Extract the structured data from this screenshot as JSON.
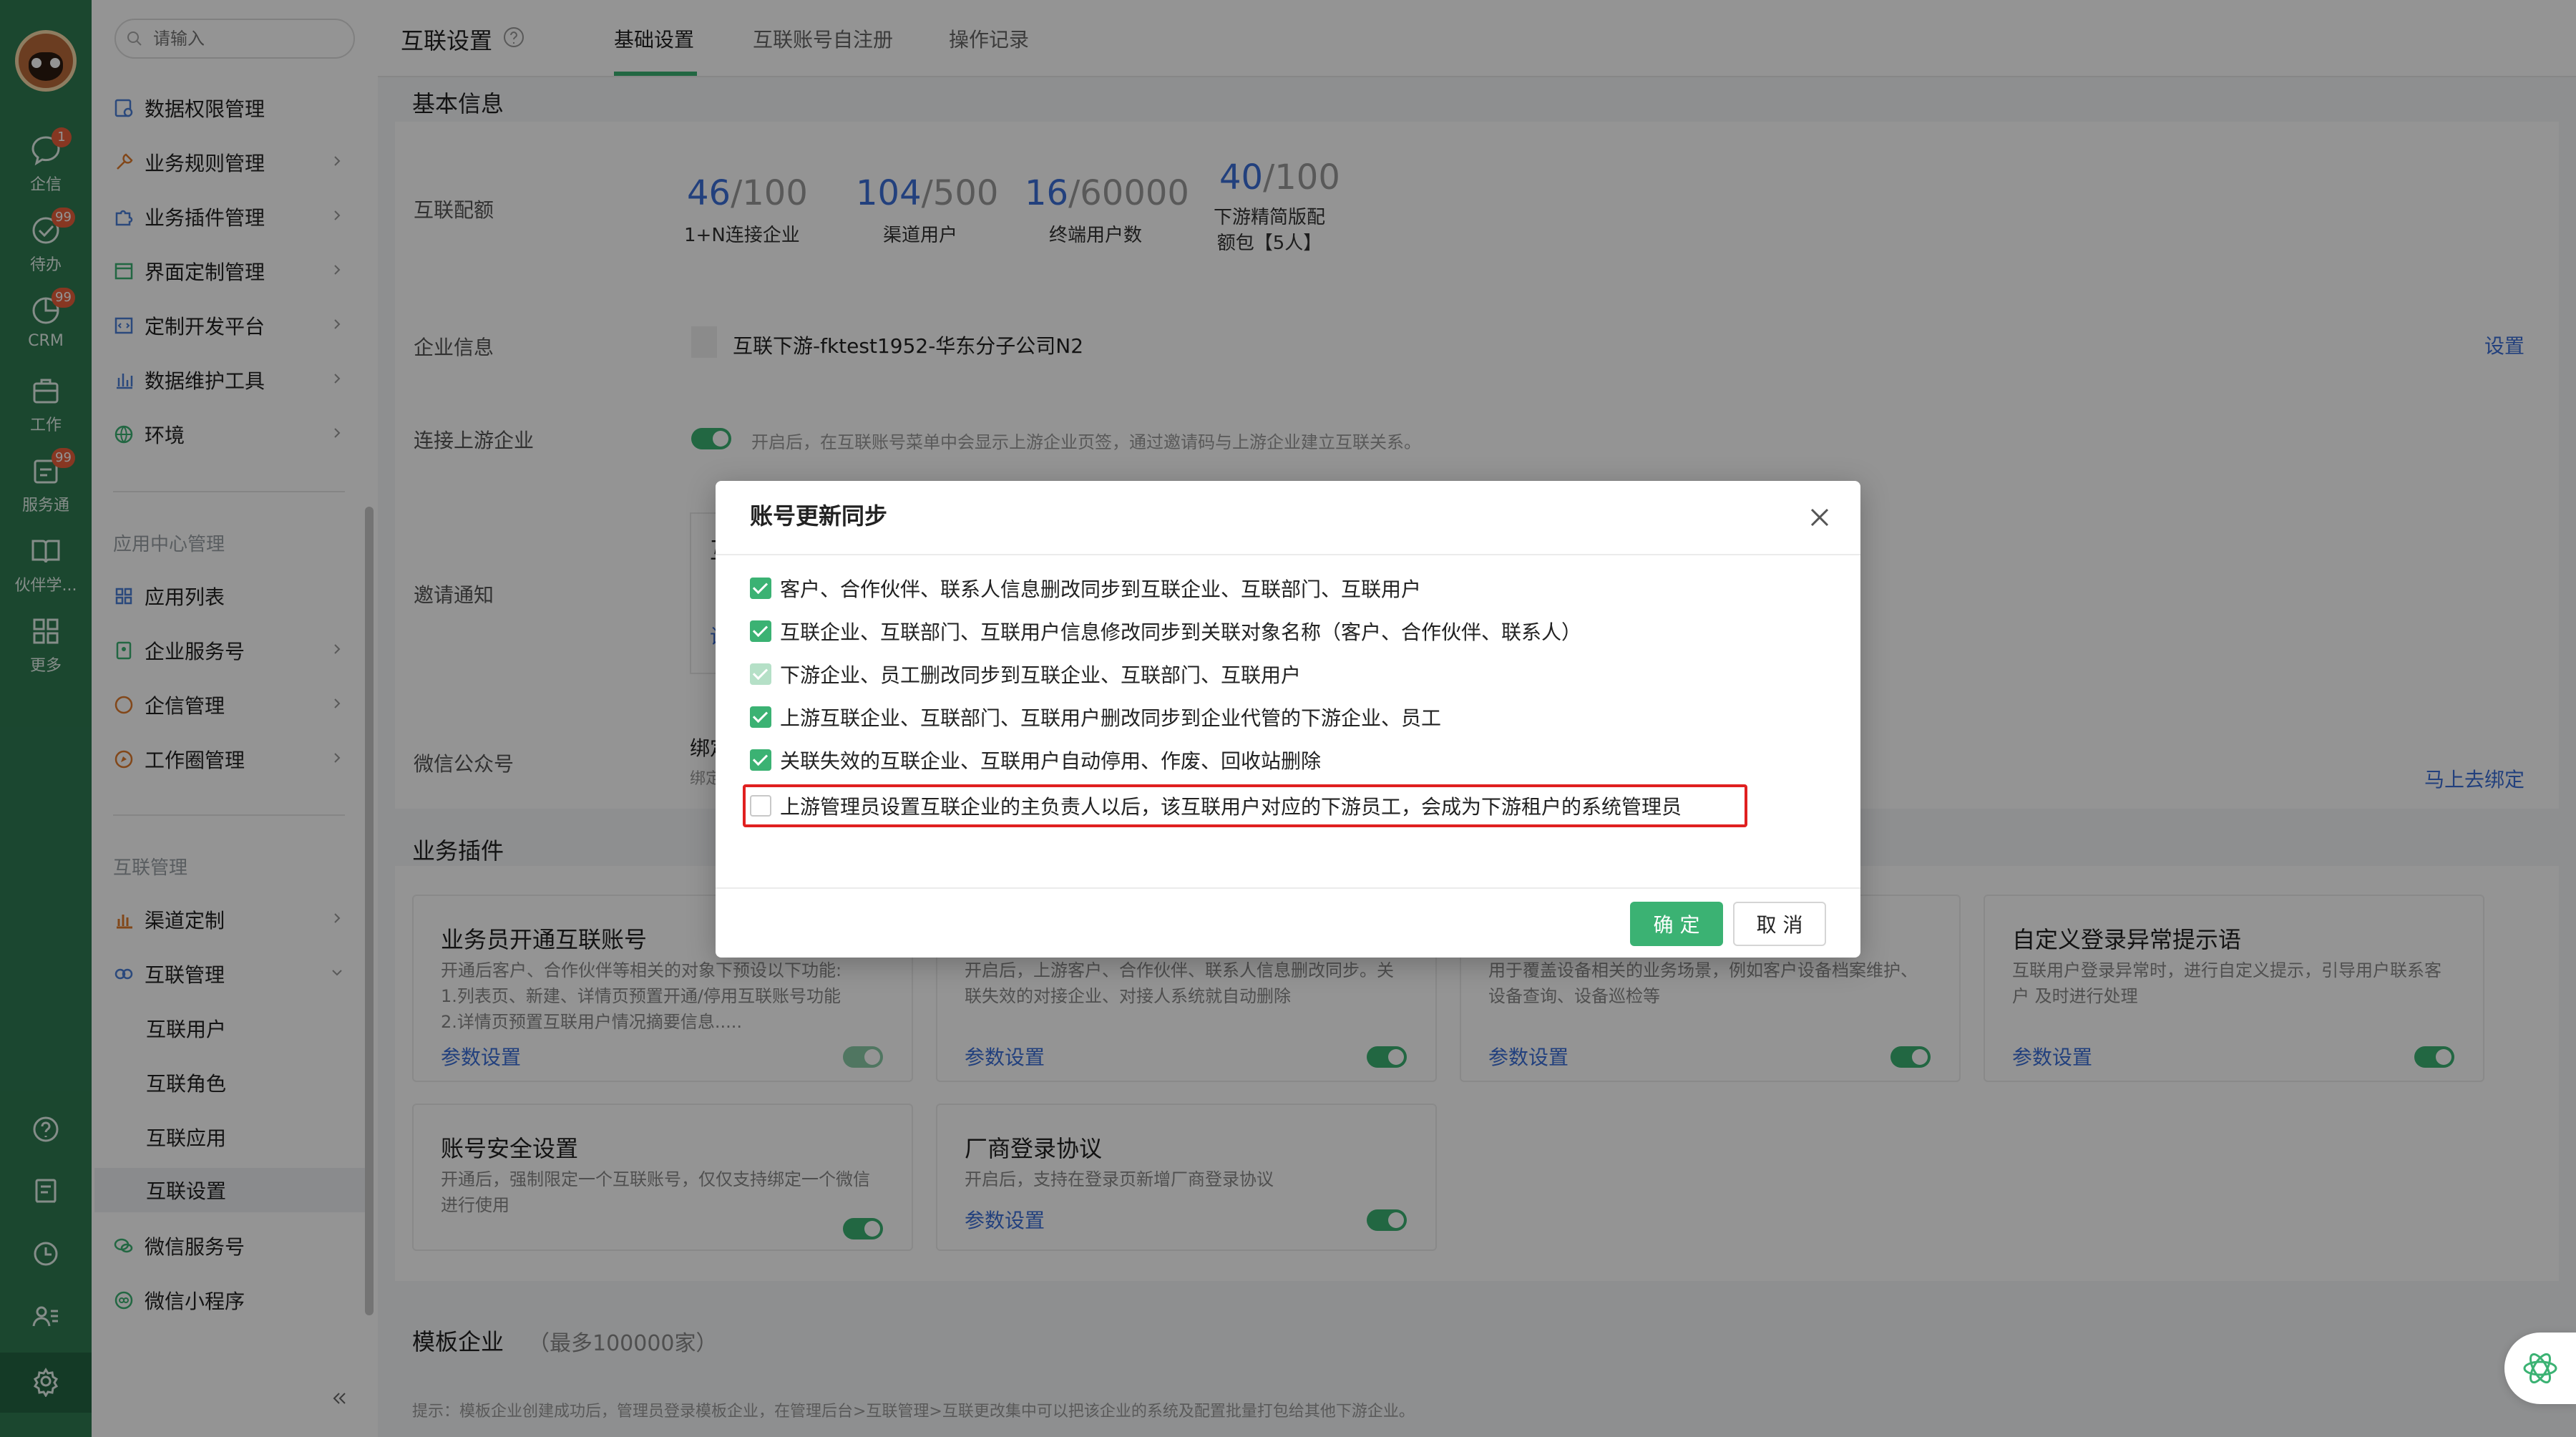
{
  "rail": {
    "items": [
      {
        "label": "企信",
        "badge": "1"
      },
      {
        "label": "待办",
        "badge": "99"
      },
      {
        "label": "CRM",
        "badge": "99"
      },
      {
        "label": "工作",
        "badge": ""
      },
      {
        "label": "服务通",
        "badge": "99"
      },
      {
        "label": "伙伴学...",
        "badge": ""
      },
      {
        "label": "更多",
        "badge": ""
      }
    ]
  },
  "menu": {
    "search_placeholder": "请输入",
    "items_top": [
      {
        "label": "数据权限管理",
        "has_chevron": false
      },
      {
        "label": "业务规则管理",
        "has_chevron": true
      },
      {
        "label": "业务插件管理",
        "has_chevron": true
      },
      {
        "label": "界面定制管理",
        "has_chevron": true
      },
      {
        "label": "定制开发平台",
        "has_chevron": true
      },
      {
        "label": "数据维护工具",
        "has_chevron": true
      },
      {
        "label": "环境",
        "has_chevron": true
      }
    ],
    "group_app": "应用中心管理",
    "items_app": [
      {
        "label": "应用列表",
        "has_chevron": false
      },
      {
        "label": "企业服务号",
        "has_chevron": true
      },
      {
        "label": "企信管理",
        "has_chevron": true
      },
      {
        "label": "工作圈管理",
        "has_chevron": true
      }
    ],
    "group_interconnect": "互联管理",
    "items_interconnect": [
      {
        "label": "渠道定制",
        "has_chevron": true
      },
      {
        "label": "互联管理",
        "has_chevron": true
      }
    ],
    "sub_items": [
      {
        "label": "互联用户"
      },
      {
        "label": "互联角色"
      },
      {
        "label": "互联应用"
      },
      {
        "label": "互联设置"
      }
    ],
    "items_bottom": [
      {
        "label": "微信服务号"
      },
      {
        "label": "微信小程序"
      }
    ],
    "collapse": "«"
  },
  "header": {
    "title": "互联设置",
    "tabs": [
      "基础设置",
      "互联账号自注册",
      "操作记录"
    ],
    "active_tab": "基础设置"
  },
  "basic": {
    "section_title": "基本信息",
    "quota_label": "互联配额",
    "quotas": [
      {
        "num": "46",
        "max": "/100",
        "label": "1+N连接企业"
      },
      {
        "num": "104",
        "max": "/500",
        "label": "渠道用户"
      },
      {
        "num": "16",
        "max": "/60000",
        "label": "终端用户数"
      },
      {
        "num": "40",
        "max": "/100",
        "label": "下游精简版配额包【5人】"
      }
    ],
    "company_label": "企业信息",
    "company_name": "互联下游-fktest1952-华东分子公司N2",
    "company_action": "设置",
    "upstream_label": "连接上游企业",
    "upstream_hint": "开启后，在互联账号菜单中会显示上游企业页签，通过邀请码与上游企业建立互联关系。",
    "invite_label": "邀请通知",
    "invite_fragment": "互",
    "invite_link_fragment": "设",
    "wechat_label": "微信公众号",
    "wechat_bind": "绑定",
    "wechat_bind_sub": "绑定",
    "wechat_action": "马上去绑定"
  },
  "plugins": {
    "section_title": "业务插件",
    "cards": [
      {
        "title": "业务员开通互联账号",
        "desc": "开通后客户、合作伙伴等相关的对象下预设以下功能:\n1.列表页、新建、详情页预置开通/停用互联账号功能\n2.详情页预置互联用户情况摘要信息.....",
        "link": "参数设置",
        "toggle": "faded"
      },
      {
        "title": "",
        "desc": "开启后，上游客户、合作伙伴、联系人信息删改同步。关联失效的对接企业、对接人系统就自动删除",
        "link": "参数设置",
        "toggle": "on"
      },
      {
        "title": "",
        "desc": "用于覆盖设备相关的业务场景，例如客户设备档案维护、设备查询、设备巡检等",
        "link": "参数设置",
        "toggle": "on"
      },
      {
        "title": "自定义登录异常提示语",
        "desc": "互联用户登录异常时，进行自定义提示，引导用户联系客户 及时进行处理",
        "link": "参数设置",
        "toggle": "on"
      },
      {
        "title": "账号安全设置",
        "desc": "开通后，强制限定一个互联账号，仅仅支持绑定一个微信进行使用",
        "link": "",
        "toggle": "on"
      },
      {
        "title": "厂商登录协议",
        "desc": "开启后，支持在登录页新增厂商登录协议",
        "link": "参数设置",
        "toggle": "on"
      }
    ]
  },
  "template": {
    "section_title": "模板企业",
    "limit": "（最多100000家）",
    "hint": "提示：模板企业创建成功后，管理员登录模板企业，在管理后台>互联管理>互联更改集中可以把该企业的系统及配置批量打包给其他下游企业。"
  },
  "modal": {
    "title": "账号更新同步",
    "options": [
      {
        "label": "客户、合作伙伴、联系人信息删改同步到互联企业、互联部门、互联用户",
        "state": "on"
      },
      {
        "label": "互联企业、互联部门、互联用户信息修改同步到关联对象名称（客户、合作伙伴、联系人）",
        "state": "on"
      },
      {
        "label": "下游企业、员工删改同步到互联企业、互联部门、互联用户",
        "state": "disabled"
      },
      {
        "label": "上游互联企业、互联部门、互联用户删改同步到企业代管的下游企业、员工",
        "state": "on"
      },
      {
        "label": "关联失效的互联企业、互联用户自动停用、作废、回收站删除",
        "state": "on"
      },
      {
        "label": "上游管理员设置互联企业的主负责人以后，该互联用户对应的下游员工，会成为下游租户的系统管理员",
        "state": "off"
      }
    ],
    "ok": "确 定",
    "cancel": "取 消"
  },
  "colors": {
    "rail": "#2f7a52",
    "accent": "#3bb273",
    "link": "#3b6fd8",
    "highlight": "#e02020"
  }
}
